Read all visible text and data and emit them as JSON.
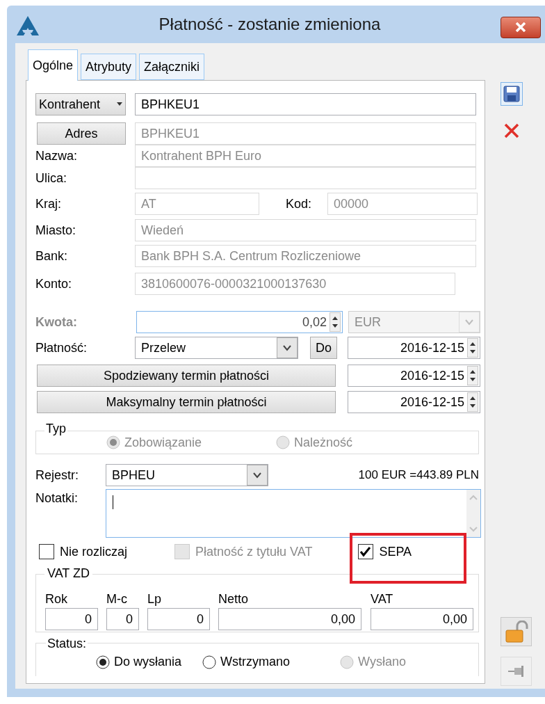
{
  "window": {
    "title": "Płatność - zostanie zmieniona"
  },
  "tabs": [
    {
      "label": "Ogólne",
      "selected": true
    },
    {
      "label": "Atrybuty",
      "selected": false
    },
    {
      "label": "Załączniki",
      "selected": false
    }
  ],
  "contractor": {
    "button": "Kontrahent",
    "value": "BPHKEU1"
  },
  "address": {
    "button": "Adres",
    "value": "BPHKEU1",
    "disabled": true
  },
  "name": {
    "label": "Nazwa:",
    "value": "Kontrahent BPH Euro",
    "disabled": true
  },
  "street": {
    "label": "Ulica:",
    "disabled": true
  },
  "country": {
    "label": "Kraj:",
    "value": "AT",
    "disabled": true
  },
  "postal_code": {
    "label": "Kod:",
    "value": "00000",
    "disabled": true
  },
  "city": {
    "label": "Miasto:",
    "value": "Wiedeń",
    "disabled": true
  },
  "bank": {
    "label": "Bank:",
    "value": "Bank BPH S.A. Centrum Rozliczeniowe",
    "disabled": true
  },
  "account": {
    "label": "Konto:",
    "value": "3810600076-0000321000137630",
    "disabled": true
  },
  "amount": {
    "label": "Kwota:",
    "value": "0,02",
    "currency": "EUR",
    "currency_disabled": true
  },
  "payment": {
    "label": "Płatność:",
    "method": "Przelew",
    "button": "Do",
    "date": "2016-12-15"
  },
  "expected_due": {
    "button": "Spodziewany termin płatności",
    "date": "2016-12-15"
  },
  "max_due": {
    "button": "Maksymalny termin płatności",
    "date": "2016-12-15"
  },
  "type_group": {
    "label": "Typ",
    "options": [
      {
        "label": "Zobowiązanie",
        "selected": true,
        "disabled": true
      },
      {
        "label": "Należność",
        "selected": false,
        "disabled": true
      }
    ]
  },
  "register": {
    "label": "Rejestr:",
    "value": "BPHEU",
    "rate": "100 EUR =443.89 PLN"
  },
  "notes": {
    "label": "Notatki:"
  },
  "checkboxes": [
    {
      "label": "Nie rozliczaj",
      "checked": false,
      "disabled": false
    },
    {
      "label": "Płatność z tytułu VAT",
      "checked": false,
      "disabled": true
    },
    {
      "label": "SEPA",
      "checked": true,
      "disabled": false
    }
  ],
  "vat_zd": {
    "title": "VAT ZD",
    "columns": [
      {
        "header": "Rok",
        "value": "0"
      },
      {
        "header": "M-c",
        "value": "0"
      },
      {
        "header": "Lp",
        "value": "0"
      },
      {
        "header": "Netto",
        "value": "0,00"
      },
      {
        "header": "VAT",
        "value": "0,00"
      }
    ]
  },
  "status": {
    "label": "Status:",
    "options": [
      {
        "label": "Do wysłania",
        "selected": true,
        "disabled": false
      },
      {
        "label": "Wstrzymano",
        "selected": false,
        "disabled": false
      },
      {
        "label": "Wysłano",
        "selected": false,
        "disabled": true
      }
    ]
  }
}
